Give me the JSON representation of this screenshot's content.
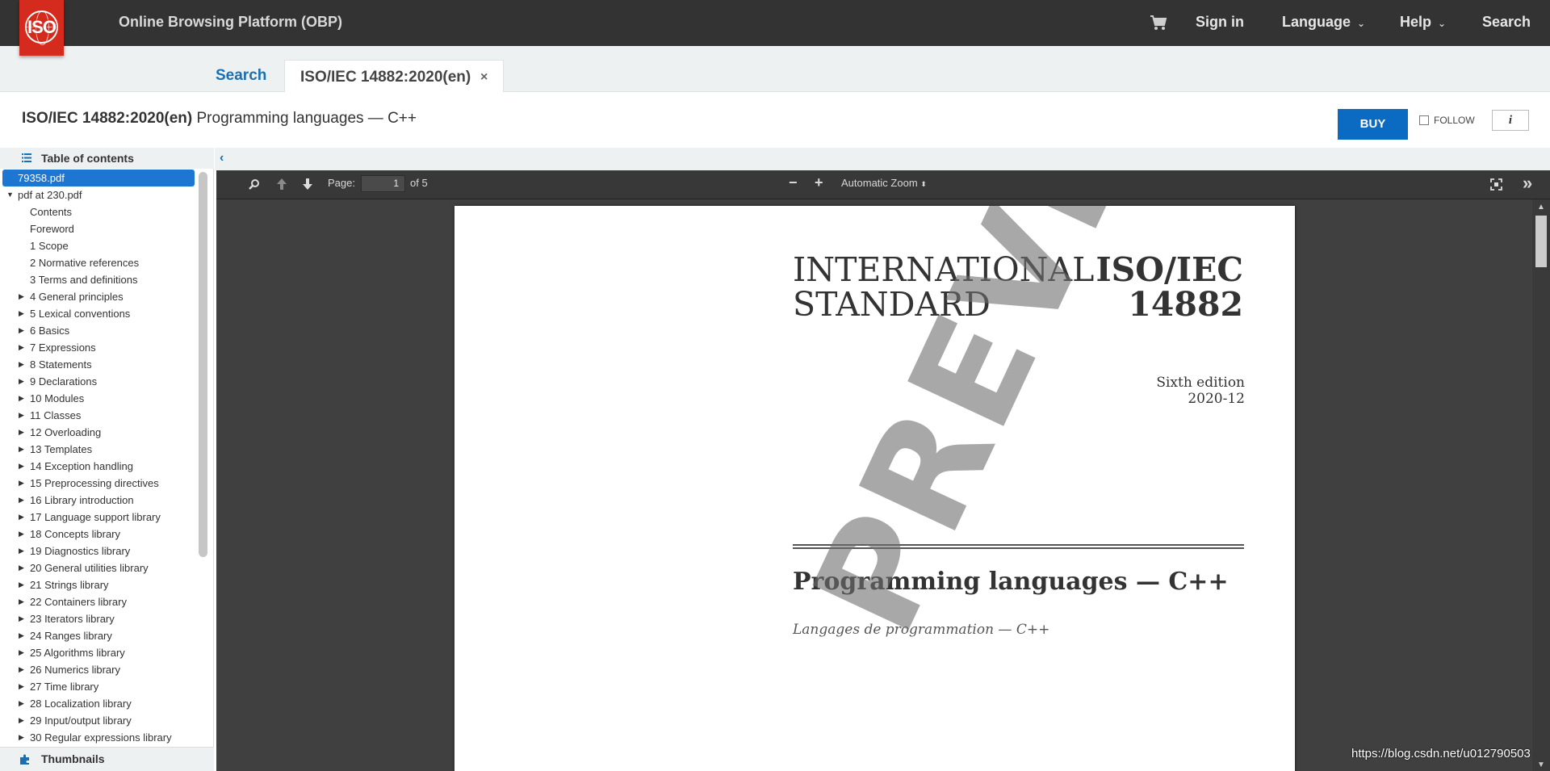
{
  "header": {
    "app_title": "Online Browsing Platform (OBP)",
    "logo_text": "ISO",
    "nav": {
      "sign_in": "Sign in",
      "language": "Language",
      "help": "Help",
      "search": "Search"
    },
    "brand_color": "#d52b1e"
  },
  "tabs": {
    "search_label": "Search",
    "active_label": "ISO/IEC 14882:2020(en)",
    "close_symbol": "×"
  },
  "document": {
    "id": "ISO/IEC 14882:2020(en)",
    "title": "Programming languages — C++",
    "buy_label": "BUY",
    "follow_label": "FOLLOW",
    "info_label": "i"
  },
  "sidebar": {
    "toc_label": "Table of contents",
    "thumbnails_label": "Thumbnails",
    "collapse_symbol": "‹",
    "items": [
      {
        "label": "79358.pdf",
        "level": 0,
        "expander": "none",
        "selected": true
      },
      {
        "label": "pdf at 230.pdf",
        "level": 0,
        "expander": "expanded",
        "selected": false
      },
      {
        "label": "Contents",
        "level": 1,
        "expander": "none"
      },
      {
        "label": "Foreword",
        "level": 1,
        "expander": "none"
      },
      {
        "label": "1 Scope",
        "level": 1,
        "expander": "none"
      },
      {
        "label": "2 Normative references",
        "level": 1,
        "expander": "none"
      },
      {
        "label": "3 Terms and definitions",
        "level": 1,
        "expander": "none"
      },
      {
        "label": "4 General principles",
        "level": 1,
        "expander": "collapsed"
      },
      {
        "label": "5 Lexical conventions",
        "level": 1,
        "expander": "collapsed"
      },
      {
        "label": "6 Basics",
        "level": 1,
        "expander": "collapsed"
      },
      {
        "label": "7 Expressions",
        "level": 1,
        "expander": "collapsed"
      },
      {
        "label": "8 Statements",
        "level": 1,
        "expander": "collapsed"
      },
      {
        "label": "9 Declarations",
        "level": 1,
        "expander": "collapsed"
      },
      {
        "label": "10 Modules",
        "level": 1,
        "expander": "collapsed"
      },
      {
        "label": "11 Classes",
        "level": 1,
        "expander": "collapsed"
      },
      {
        "label": "12 Overloading",
        "level": 1,
        "expander": "collapsed"
      },
      {
        "label": "13 Templates",
        "level": 1,
        "expander": "collapsed"
      },
      {
        "label": "14 Exception handling",
        "level": 1,
        "expander": "collapsed"
      },
      {
        "label": "15 Preprocessing directives",
        "level": 1,
        "expander": "collapsed"
      },
      {
        "label": "16 Library introduction",
        "level": 1,
        "expander": "collapsed"
      },
      {
        "label": "17 Language support library",
        "level": 1,
        "expander": "collapsed"
      },
      {
        "label": "18 Concepts library",
        "level": 1,
        "expander": "collapsed"
      },
      {
        "label": "19 Diagnostics library",
        "level": 1,
        "expander": "collapsed"
      },
      {
        "label": "20 General utilities library",
        "level": 1,
        "expander": "collapsed"
      },
      {
        "label": "21 Strings library",
        "level": 1,
        "expander": "collapsed"
      },
      {
        "label": "22 Containers library",
        "level": 1,
        "expander": "collapsed"
      },
      {
        "label": "23 Iterators library",
        "level": 1,
        "expander": "collapsed"
      },
      {
        "label": "24 Ranges library",
        "level": 1,
        "expander": "collapsed"
      },
      {
        "label": "25 Algorithms library",
        "level": 1,
        "expander": "collapsed"
      },
      {
        "label": "26 Numerics library",
        "level": 1,
        "expander": "collapsed"
      },
      {
        "label": "27 Time library",
        "level": 1,
        "expander": "collapsed"
      },
      {
        "label": "28 Localization library",
        "level": 1,
        "expander": "collapsed"
      },
      {
        "label": "29 Input/output library",
        "level": 1,
        "expander": "collapsed"
      },
      {
        "label": "30 Regular expressions library",
        "level": 1,
        "expander": "collapsed"
      }
    ]
  },
  "viewer": {
    "page_label": "Page:",
    "page_value": "1",
    "page_total": "of 5",
    "zoom_out": "−",
    "zoom_in": "+",
    "zoom_value": "Automatic Zoom",
    "zoom_caret": "⬍",
    "more": "»"
  },
  "page_content": {
    "standard_line1": "INTERNATIONAL",
    "standard_line2": "STANDARD",
    "number_line1": "ISO/IEC",
    "number_line2": "14882",
    "edition": "Sixth edition",
    "date": "2020-12",
    "title_en": "Programming languages — C++",
    "title_fr": "Langages de programmation — C++",
    "watermark": "PREVIEW"
  },
  "overlay_url": "https://blog.csdn.net/u012790503"
}
